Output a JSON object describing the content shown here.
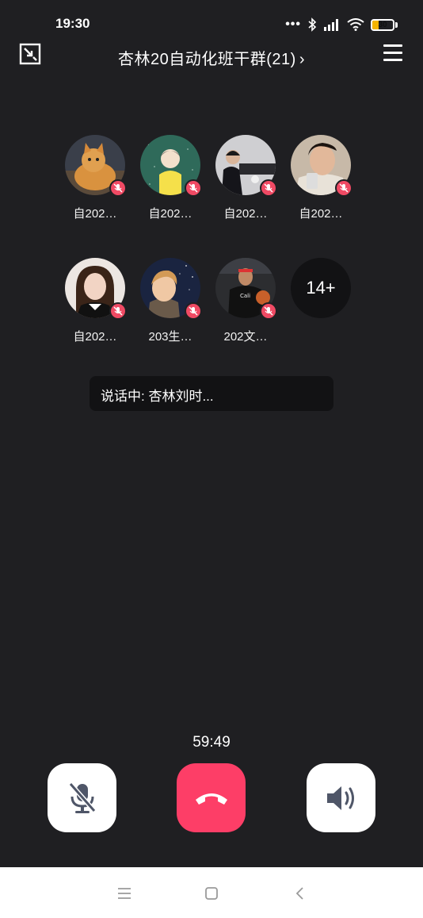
{
  "status": {
    "time": "19:30",
    "dots": "•••",
    "battery": "30"
  },
  "header": {
    "title": "杏林20自动化班干群(21)",
    "chevron": "›"
  },
  "members": [
    {
      "name": "自202…",
      "avatar": "cat",
      "muted": true
    },
    {
      "name": "自202…",
      "avatar": "anime-yellow",
      "muted": true
    },
    {
      "name": "自202…",
      "avatar": "man-kitchen",
      "muted": true
    },
    {
      "name": "自202…",
      "avatar": "man-selfie",
      "muted": true
    },
    {
      "name": "自202…",
      "avatar": "woman",
      "muted": true
    },
    {
      "name": "203生…",
      "avatar": "anime-sky",
      "muted": true
    },
    {
      "name": "202文…",
      "avatar": "basketball",
      "muted": true
    }
  ],
  "more": "14+",
  "speaking": "说话中: 杏林刘时...",
  "timer": "59:49",
  "colors": {
    "background": "#1f1f22",
    "hangup": "#fd3e67",
    "mute_badge": "#f04a64"
  },
  "icons": {
    "minimize": "minimize-icon",
    "menu": "menu-icon",
    "mic_off": "mic-off-icon",
    "hangup": "phone-hangup-icon",
    "speaker": "speaker-icon"
  }
}
